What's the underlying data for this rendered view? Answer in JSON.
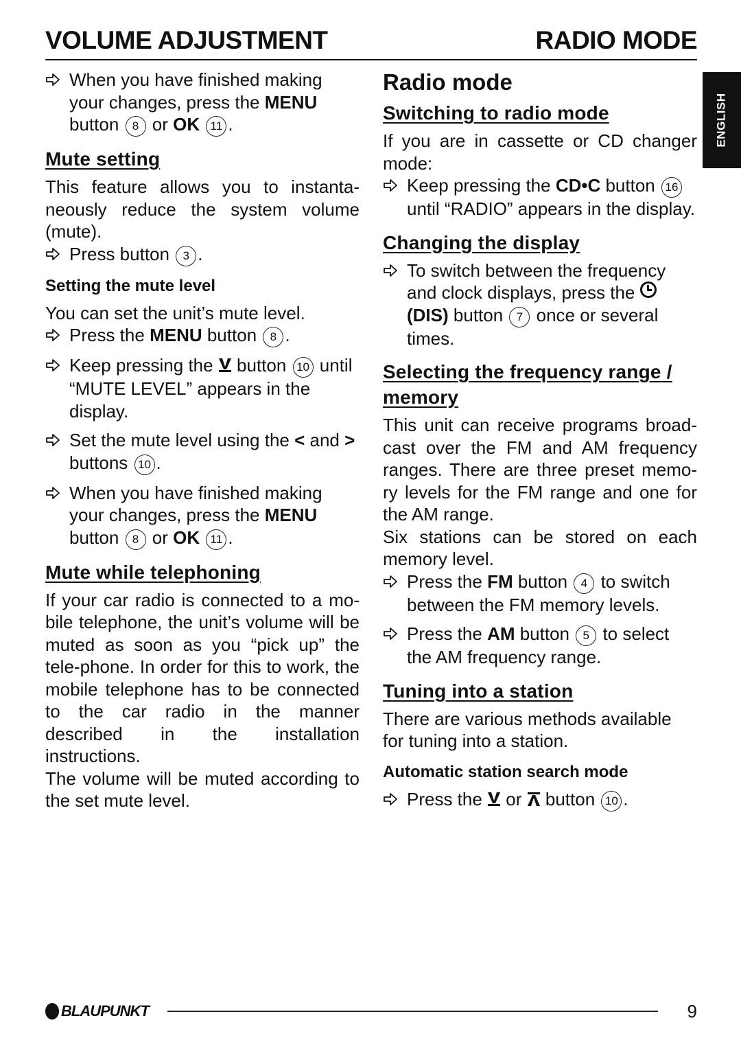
{
  "header": {
    "left_title": "VOLUME ADJUSTMENT",
    "right_title": "RADIO MODE"
  },
  "language_tab": "ENGLISH",
  "left": {
    "intro_bullet": {
      "t1": "When you have finished making your changes, press the ",
      "b1": "MENU",
      "t2": " button ",
      "n1": "8",
      "t3": " or ",
      "b2": "OK",
      "t4": " ",
      "n2": "11",
      "t5": "."
    },
    "mute_setting": {
      "heading": "Mute setting",
      "body": "This feature allows you to instanta-neously reduce the system volume (mute).",
      "bullet": {
        "t1": "Press button ",
        "n1": "3",
        "t2": "."
      }
    },
    "mute_level": {
      "heading": "Setting the mute level",
      "body": "You can set the unit’s mute level.",
      "b1": {
        "t1": "Press the ",
        "bold": "MENU",
        "t2": " button ",
        "n1": "8",
        "t3": "."
      },
      "b2": {
        "t1": "Keep pressing the ",
        "sym": "ⅴ",
        "t2": " button ",
        "n1": "10",
        "t3": " until “MUTE LEVEL” appears in the display."
      },
      "b3": {
        "t1": "Set the mute level using the ",
        "sym1": "<",
        "t2": " and ",
        "sym2": ">",
        "t3": " buttons ",
        "n1": "10",
        "t4": "."
      },
      "b4": {
        "t1": "When you have finished making your changes, press the ",
        "b1": "MENU",
        "t2": " button ",
        "n1": "8",
        "t3": " or ",
        "b2": "OK",
        "t4": " ",
        "n2": "11",
        "t5": "."
      }
    },
    "mute_phone": {
      "heading": "Mute while telephoning",
      "p1": "If your car radio is connected to a mo-bile telephone, the unit’s volume will be muted as soon as you “pick up” the tele-phone. In order for this to work, the mobile telephone has to be connected to the car radio in the manner described in the installation instructions.",
      "p2": "The volume will be muted according to the set mute level."
    }
  },
  "right": {
    "title": "Radio mode",
    "switching": {
      "heading": "Switching to radio mode",
      "body": "If you are in cassette or CD changer mode:",
      "bullet": {
        "t1": "Keep pressing the ",
        "bold": "CD•C",
        "t2": " button ",
        "n1": "16",
        "t3": " until “RADIO” appears in the display."
      }
    },
    "display": {
      "heading": "Changing the display",
      "bullet": {
        "t1": "To switch between the frequency and clock displays, press the ",
        "bold": "(DIS)",
        "t2": " button ",
        "n1": "7",
        "t3": " once or several times."
      }
    },
    "frequency": {
      "heading": "Selecting the frequency range / memory",
      "p1": "This unit can receive programs broad-cast over the FM and AM frequency ranges. There are three preset memo-ry levels for the FM range and one for the AM range.",
      "p2": "Six stations can be stored on each memory level.",
      "b1": {
        "t1": "Press the ",
        "bold": "FM",
        "t2": " button ",
        "n1": "4",
        "t3": " to switch between the FM memory levels."
      },
      "b2": {
        "t1": "Press the ",
        "bold": "AM",
        "t2": " button ",
        "n1": "5",
        "t3": " to select the AM frequency range."
      }
    },
    "tuning": {
      "heading": "Tuning into a station",
      "body": "There are various methods available for tuning into a station.",
      "subheading": "Automatic station search mode",
      "bullet": {
        "t1": "Press the ",
        "t2": " or ",
        "t3": " button ",
        "n1": "10",
        "t4": "."
      }
    }
  },
  "footer": {
    "brand": "BLAUPUNKT",
    "page_number": "9"
  }
}
